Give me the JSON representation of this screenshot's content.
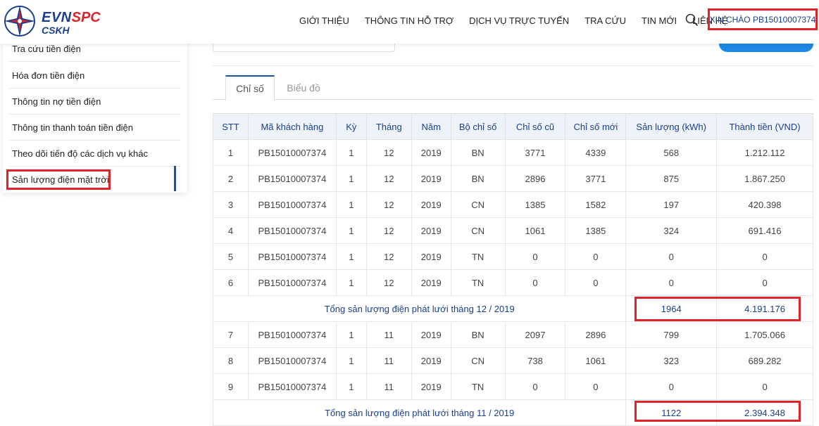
{
  "header": {
    "logo": {
      "evn": "EVN",
      "spc": "SPC",
      "cskh": "CSKH"
    },
    "nav": [
      "GIỚI THIỆU",
      "THÔNG TIN HỖ TRỢ",
      "DỊCH VỤ TRỰC TUYẾN",
      "TRA CỨU",
      "TIN MỚI",
      "LIÊN HỆ"
    ],
    "greeting": "XIN CHÀO PB15010007374"
  },
  "sidebar": {
    "items": [
      "Tra cứu tiền điện",
      "Hóa đơn tiền điện",
      "Thông tin nợ tiền điện",
      "Thông tin thanh toán tiền điện",
      "Theo dõi tiến độ các dịch vụ khác",
      "Sản lượng điện mặt trời"
    ],
    "active_index": 5
  },
  "tabs": [
    "Chỉ số",
    "Biểu đồ"
  ],
  "table": {
    "headers": [
      "STT",
      "Mã khách hàng",
      "Kỳ",
      "Tháng",
      "Năm",
      "Bộ chỉ số",
      "Chỉ số cũ",
      "Chỉ số mới",
      "Sản lượng (kWh)",
      "Thành tiền (VND)"
    ],
    "groups": [
      {
        "rows": [
          [
            "1",
            "PB15010007374",
            "1",
            "12",
            "2019",
            "BN",
            "3771",
            "4339",
            "568",
            "1.212.112"
          ],
          [
            "2",
            "PB15010007374",
            "1",
            "12",
            "2019",
            "BN",
            "2896",
            "3771",
            "875",
            "1.867.250"
          ],
          [
            "3",
            "PB15010007374",
            "1",
            "12",
            "2019",
            "CN",
            "1385",
            "1582",
            "197",
            "420.398"
          ],
          [
            "4",
            "PB15010007374",
            "1",
            "12",
            "2019",
            "CN",
            "1061",
            "1385",
            "324",
            "691.416"
          ],
          [
            "5",
            "PB15010007374",
            "1",
            "12",
            "2019",
            "TN",
            "0",
            "0",
            "0",
            "0"
          ],
          [
            "6",
            "PB15010007374",
            "1",
            "12",
            "2019",
            "TN",
            "0",
            "0",
            "0",
            "0"
          ]
        ],
        "summary": {
          "label": "Tổng sản lượng điện phát lưới tháng 12 / 2019",
          "kwh": "1964",
          "vnd": "4.191.176"
        }
      },
      {
        "rows": [
          [
            "7",
            "PB15010007374",
            "1",
            "11",
            "2019",
            "BN",
            "2097",
            "2896",
            "799",
            "1.705.066"
          ],
          [
            "8",
            "PB15010007374",
            "1",
            "11",
            "2019",
            "CN",
            "738",
            "1061",
            "323",
            "689.282"
          ],
          [
            "9",
            "PB15010007374",
            "1",
            "11",
            "2019",
            "TN",
            "0",
            "0",
            "0",
            "0"
          ]
        ],
        "summary": {
          "label": "Tổng sản lượng điện phát lưới tháng 11 / 2019",
          "kwh": "1122",
          "vnd": "2.394.348"
        }
      }
    ]
  },
  "colors": {
    "brand_blue": "#1b3f8f",
    "brand_red": "#e0222b",
    "highlight": "#e0222b"
  }
}
